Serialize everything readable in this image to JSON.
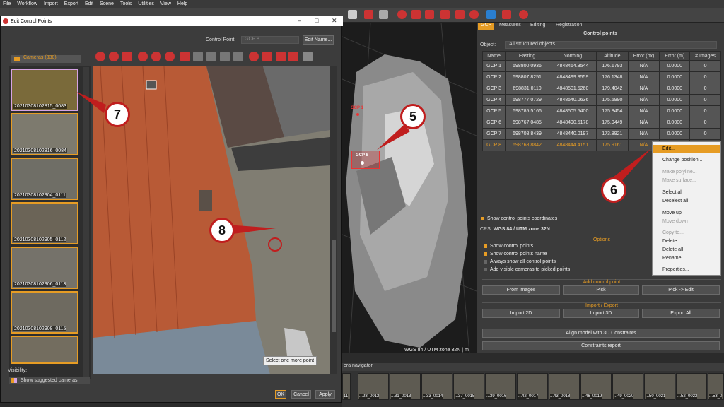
{
  "menu": [
    "File",
    "Workflow",
    "Import",
    "Export",
    "Edit",
    "Scene",
    "Tools",
    "Utilities",
    "View",
    "Help"
  ],
  "dialog": {
    "title": "Edit Control Points",
    "control_point_label": "Control Point:",
    "control_point_value": "GCP 8",
    "edit_name_button": "Edit Name...",
    "cameras_header": "Cameras (330)",
    "thumbnails": [
      "20210308102815_0083",
      "20210308102816_0084",
      "20210308102904_0111",
      "20210308102905_0112",
      "20210308102906_0113",
      "20210308102908_0115",
      ""
    ],
    "visibility_label": "Visibility:",
    "show_suggested": "Show suggested cameras",
    "tooltip": "Select one more point",
    "ok": "OK",
    "cancel": "Cancel",
    "apply": "Apply"
  },
  "viewport": {
    "gcp1": "GCP 1",
    "gcp8": "GCP 8",
    "status": "WGS 84 / UTM zone 32N | m"
  },
  "panel": {
    "tabs": [
      "GCP",
      "Measures",
      "Editing",
      "Registration"
    ],
    "title": "Control points",
    "object_label": "Object:",
    "object_value": "All structured objects",
    "columns": [
      "Name",
      "Easting",
      "Northing",
      "Altitude",
      "Error (px)",
      "Error (m)",
      "# Images"
    ],
    "rows": [
      [
        "GCP 1",
        "698800.0936",
        "4848464.3544",
        "176.1793",
        "N/A",
        "0.0000",
        "0"
      ],
      [
        "GCP 2",
        "698807.8251",
        "4848499.8559",
        "176.1348",
        "N/A",
        "0.0000",
        "0"
      ],
      [
        "GCP 3",
        "698831.0110",
        "4848501.5260",
        "179.4042",
        "N/A",
        "0.0000",
        "0"
      ],
      [
        "GCP 4",
        "698777.0729",
        "4848540.0636",
        "175.5990",
        "N/A",
        "0.0000",
        "0"
      ],
      [
        "GCP 5",
        "698785.5166",
        "4848505.5400",
        "175.8454",
        "N/A",
        "0.0000",
        "0"
      ],
      [
        "GCP 6",
        "698767.0485",
        "4848490.5178",
        "175.9449",
        "N/A",
        "0.0000",
        "0"
      ],
      [
        "GCP 7",
        "698708.8439",
        "4848440.0197",
        "173.8921",
        "N/A",
        "0.0000",
        "0"
      ],
      [
        "GCP 8",
        "698768.8842",
        "4848444.4151",
        "175.9161",
        "N/A",
        "",
        ""
      ]
    ],
    "show_coords": "Show control points coordinates",
    "crs_label": "CRS:",
    "crs_value": "WGS 84 / UTM zone 32N",
    "options_header": "Options",
    "opt1": "Show control points",
    "opt2": "Show control points name",
    "opt3": "Always show all control points",
    "opt4": "Add visible cameras to picked points",
    "add_header": "Add control point",
    "from_images": "From images",
    "pick": "Pick",
    "pick_edit": "Pick -> Edit",
    "ie_header": "Import / Export",
    "import2d": "Import 2D",
    "import3d": "Import 3D",
    "export_all": "Export All",
    "align": "Align model with 3D Constraints",
    "report": "Constraints report"
  },
  "context_menu": [
    "Edit...",
    "Change position...",
    "Make polyline...",
    "Make surface...",
    "Select all",
    "Deselect all",
    "Move up",
    "Move down",
    "Copy to...",
    "Delete",
    "Delete all",
    "Rename...",
    "Properties..."
  ],
  "navigator": {
    "title": "era navigator",
    "items": [
      "11",
      "...28_0012",
      "...31_0013",
      "...33_0014",
      "...37_0015",
      "...39_0016",
      "...42_0017",
      "...43_0018",
      "...46_0019",
      "...49_0020",
      "...50_0021",
      "...52_0022",
      "...53_0"
    ]
  },
  "callouts": [
    "7",
    "5",
    "8",
    "6"
  ],
  "colors": {
    "accent": "#e69c24",
    "callout_border": "#c01e1e",
    "roof": "#b85a36"
  }
}
